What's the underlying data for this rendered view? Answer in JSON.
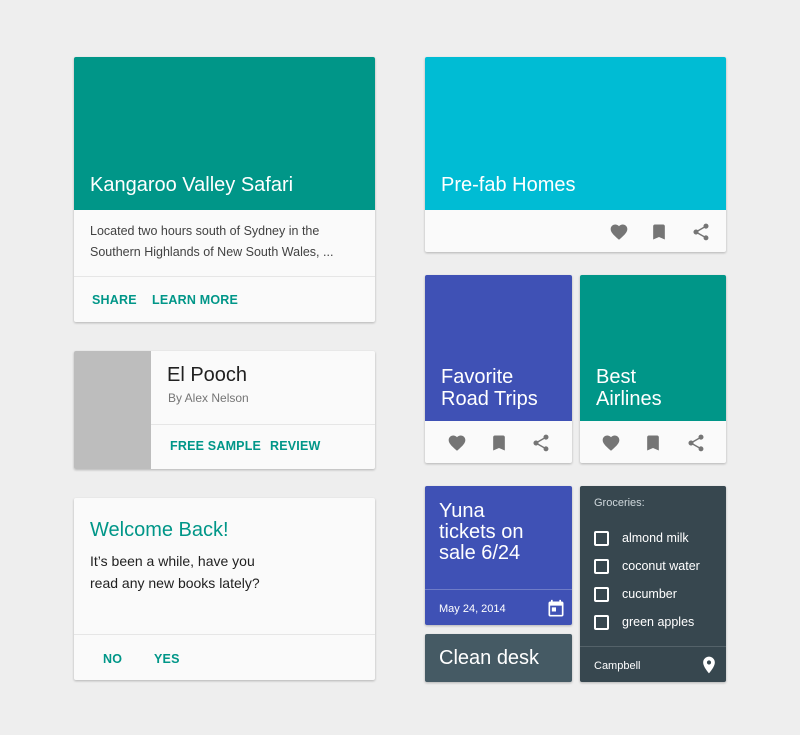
{
  "colors": {
    "teal": "#009688",
    "cyan": "#00bcd4",
    "indigo": "#3f51b5",
    "blue_grey": "#37474f",
    "slate": "#455a64",
    "gray_thumb": "#bdbdbd",
    "background": "#eeeeee"
  },
  "kangaroo_card": {
    "title": "Kangaroo Valley Safari",
    "body_line1": "Located two hours south of Sydney in the",
    "body_line2": "Southern Highlands of New South Wales, ...",
    "share_label": "SHARE",
    "learn_more_label": "LEARN MORE"
  },
  "pooch_card": {
    "title": "El Pooch",
    "author": "By Alex Nelson",
    "free_sample_label": "FREE SAMPLE",
    "review_label": "REVIEW"
  },
  "welcome_card": {
    "title": "Welcome Back!",
    "body_line1": "It’s been a while, have you",
    "body_line2": "read any new books lately?",
    "no_label": "NO",
    "yes_label": "YES"
  },
  "prefab_card": {
    "title": "Pre-fab Homes",
    "icons": [
      "heart-icon",
      "bookmark-icon",
      "share-icon"
    ]
  },
  "road_trips_card": {
    "title_line1": "Favorite",
    "title_line2": "Road Trips",
    "icons": [
      "heart-icon",
      "bookmark-icon",
      "share-icon"
    ]
  },
  "airlines_card": {
    "title_line1": "Best",
    "title_line2": "Airlines",
    "icons": [
      "heart-icon",
      "bookmark-icon",
      "share-icon"
    ]
  },
  "yuna_card": {
    "title_line1": "Yuna",
    "title_line2": "tickets on",
    "title_line3": "sale 6/24",
    "date": "May 24, 2014",
    "icon": "calendar-icon"
  },
  "clean_desk_card": {
    "title": "Clean desk"
  },
  "groceries_card": {
    "title": "Groceries:",
    "items": [
      {
        "label": "almond milk",
        "checked": false
      },
      {
        "label": "coconut water",
        "checked": false
      },
      {
        "label": "cucumber",
        "checked": false
      },
      {
        "label": "green apples",
        "checked": false
      }
    ],
    "location": "Campbell",
    "icon": "location-pin-icon"
  }
}
